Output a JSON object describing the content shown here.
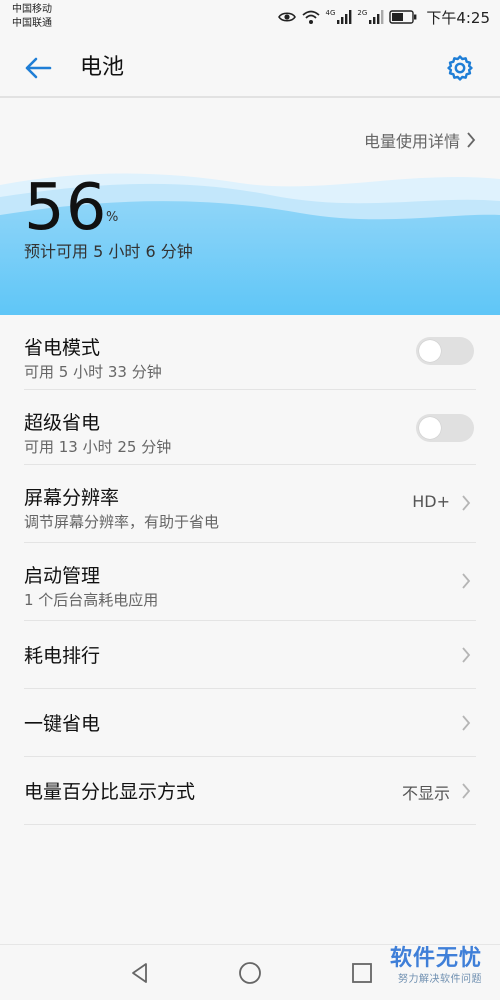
{
  "status_bar": {
    "carrier_1": "中国移动",
    "carrier_2": "中国联通",
    "net_1": "4G",
    "net_2": "2G",
    "time": "下午4:25"
  },
  "header": {
    "title": "电池",
    "back_icon": "arrow-left-icon",
    "settings_icon": "gear-icon"
  },
  "battery": {
    "detail_link": "电量使用详情",
    "percent": "56",
    "percent_unit": "%",
    "estimate": "预计可用 5 小时 6 分钟"
  },
  "settings": {
    "power_saving": {
      "title": "省电模式",
      "subtitle": "可用 5 小时 33 分钟",
      "enabled": false
    },
    "ultra_power_saving": {
      "title": "超级省电",
      "subtitle": "可用 13 小时 25 分钟",
      "enabled": false
    },
    "screen_resolution": {
      "title": "屏幕分辨率",
      "subtitle": "调节屏幕分辨率，有助于省电",
      "value": "HD+"
    },
    "launch_manager": {
      "title": "启动管理",
      "subtitle": "1 个后台高耗电应用"
    },
    "consumption_ranking": {
      "title": "耗电排行"
    },
    "one_tap_saving": {
      "title": "一键省电"
    },
    "percentage_display": {
      "title": "电量百分比显示方式",
      "value": "不显示"
    }
  },
  "watermark": {
    "title": "软件无忧",
    "subtitle": "努力解决软件问题"
  },
  "colors": {
    "accent": "#1f7ed6",
    "wave_light": "#c8e9fb",
    "wave_mid": "#8fd5f8",
    "wave_deep": "#5fc6f7"
  }
}
